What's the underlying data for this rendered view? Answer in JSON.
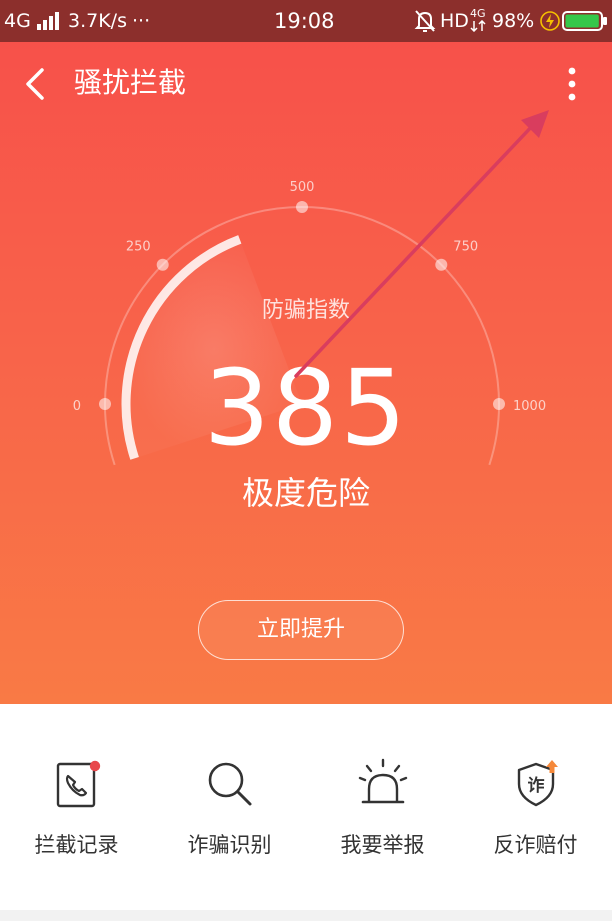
{
  "status_bar": {
    "network": "4G",
    "speed": "3.7K/s",
    "dots": "···",
    "time": "19:08",
    "hd": "HD",
    "net_small": "4G",
    "battery_percent": "98%",
    "background_color": "#8c2f2c",
    "battery_level": 0.98
  },
  "toolbar": {
    "title": "骚扰拦截",
    "back_icon": "chevron-left-icon",
    "more_icon": "more-vertical-icon"
  },
  "gauge": {
    "min": 0,
    "max": 1000,
    "ticks": [
      {
        "value": 0,
        "label": "0"
      },
      {
        "value": 250,
        "label": "250"
      },
      {
        "value": 500,
        "label": "500"
      },
      {
        "value": 750,
        "label": "750"
      },
      {
        "value": 1000,
        "label": "1000"
      }
    ],
    "caption": "防骗指数",
    "score": 385,
    "score_text": "385",
    "level": "极度危险"
  },
  "actions": {
    "boost_label": "立即提升"
  },
  "features": [
    {
      "label": "拦截记录",
      "icon": "phone-record-icon",
      "badge": true
    },
    {
      "label": "诈骗识别",
      "icon": "search-icon"
    },
    {
      "label": "我要举报",
      "icon": "alarm-siren-icon"
    },
    {
      "label": "反诈赔付",
      "icon": "shield-fraud-icon",
      "icon_text": "诈"
    }
  ],
  "colors": {
    "hero_top": "#f7514a",
    "hero_bottom": "#f97a45",
    "annotation_arrow": "#d93d5e",
    "badge": "#e8484c",
    "upgrade_arrow": "#f5883a",
    "battery": "#35c74a",
    "charging": "#f5c000"
  }
}
